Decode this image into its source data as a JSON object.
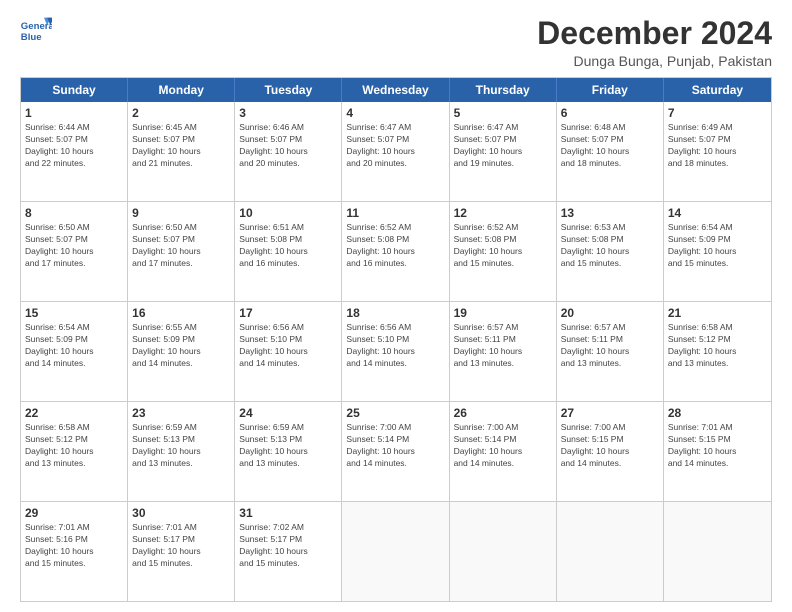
{
  "logo": {
    "line1": "General",
    "line2": "Blue"
  },
  "title": "December 2024",
  "subtitle": "Dunga Bunga, Punjab, Pakistan",
  "days_of_week": [
    "Sunday",
    "Monday",
    "Tuesday",
    "Wednesday",
    "Thursday",
    "Friday",
    "Saturday"
  ],
  "weeks": [
    [
      {
        "day": "1",
        "sunrise": "Sunrise: 6:44 AM",
        "sunset": "Sunset: 5:07 PM",
        "daylight": "Daylight: 10 hours and 22 minutes."
      },
      {
        "day": "2",
        "sunrise": "Sunrise: 6:45 AM",
        "sunset": "Sunset: 5:07 PM",
        "daylight": "Daylight: 10 hours and 21 minutes."
      },
      {
        "day": "3",
        "sunrise": "Sunrise: 6:46 AM",
        "sunset": "Sunset: 5:07 PM",
        "daylight": "Daylight: 10 hours and 20 minutes."
      },
      {
        "day": "4",
        "sunrise": "Sunrise: 6:47 AM",
        "sunset": "Sunset: 5:07 PM",
        "daylight": "Daylight: 10 hours and 20 minutes."
      },
      {
        "day": "5",
        "sunrise": "Sunrise: 6:47 AM",
        "sunset": "Sunset: 5:07 PM",
        "daylight": "Daylight: 10 hours and 19 minutes."
      },
      {
        "day": "6",
        "sunrise": "Sunrise: 6:48 AM",
        "sunset": "Sunset: 5:07 PM",
        "daylight": "Daylight: 10 hours and 18 minutes."
      },
      {
        "day": "7",
        "sunrise": "Sunrise: 6:49 AM",
        "sunset": "Sunset: 5:07 PM",
        "daylight": "Daylight: 10 hours and 18 minutes."
      }
    ],
    [
      {
        "day": "8",
        "sunrise": "Sunrise: 6:50 AM",
        "sunset": "Sunset: 5:07 PM",
        "daylight": "Daylight: 10 hours and 17 minutes."
      },
      {
        "day": "9",
        "sunrise": "Sunrise: 6:50 AM",
        "sunset": "Sunset: 5:07 PM",
        "daylight": "Daylight: 10 hours and 17 minutes."
      },
      {
        "day": "10",
        "sunrise": "Sunrise: 6:51 AM",
        "sunset": "Sunset: 5:08 PM",
        "daylight": "Daylight: 10 hours and 16 minutes."
      },
      {
        "day": "11",
        "sunrise": "Sunrise: 6:52 AM",
        "sunset": "Sunset: 5:08 PM",
        "daylight": "Daylight: 10 hours and 16 minutes."
      },
      {
        "day": "12",
        "sunrise": "Sunrise: 6:52 AM",
        "sunset": "Sunset: 5:08 PM",
        "daylight": "Daylight: 10 hours and 15 minutes."
      },
      {
        "day": "13",
        "sunrise": "Sunrise: 6:53 AM",
        "sunset": "Sunset: 5:08 PM",
        "daylight": "Daylight: 10 hours and 15 minutes."
      },
      {
        "day": "14",
        "sunrise": "Sunrise: 6:54 AM",
        "sunset": "Sunset: 5:09 PM",
        "daylight": "Daylight: 10 hours and 15 minutes."
      }
    ],
    [
      {
        "day": "15",
        "sunrise": "Sunrise: 6:54 AM",
        "sunset": "Sunset: 5:09 PM",
        "daylight": "Daylight: 10 hours and 14 minutes."
      },
      {
        "day": "16",
        "sunrise": "Sunrise: 6:55 AM",
        "sunset": "Sunset: 5:09 PM",
        "daylight": "Daylight: 10 hours and 14 minutes."
      },
      {
        "day": "17",
        "sunrise": "Sunrise: 6:56 AM",
        "sunset": "Sunset: 5:10 PM",
        "daylight": "Daylight: 10 hours and 14 minutes."
      },
      {
        "day": "18",
        "sunrise": "Sunrise: 6:56 AM",
        "sunset": "Sunset: 5:10 PM",
        "daylight": "Daylight: 10 hours and 14 minutes."
      },
      {
        "day": "19",
        "sunrise": "Sunrise: 6:57 AM",
        "sunset": "Sunset: 5:11 PM",
        "daylight": "Daylight: 10 hours and 13 minutes."
      },
      {
        "day": "20",
        "sunrise": "Sunrise: 6:57 AM",
        "sunset": "Sunset: 5:11 PM",
        "daylight": "Daylight: 10 hours and 13 minutes."
      },
      {
        "day": "21",
        "sunrise": "Sunrise: 6:58 AM",
        "sunset": "Sunset: 5:12 PM",
        "daylight": "Daylight: 10 hours and 13 minutes."
      }
    ],
    [
      {
        "day": "22",
        "sunrise": "Sunrise: 6:58 AM",
        "sunset": "Sunset: 5:12 PM",
        "daylight": "Daylight: 10 hours and 13 minutes."
      },
      {
        "day": "23",
        "sunrise": "Sunrise: 6:59 AM",
        "sunset": "Sunset: 5:13 PM",
        "daylight": "Daylight: 10 hours and 13 minutes."
      },
      {
        "day": "24",
        "sunrise": "Sunrise: 6:59 AM",
        "sunset": "Sunset: 5:13 PM",
        "daylight": "Daylight: 10 hours and 13 minutes."
      },
      {
        "day": "25",
        "sunrise": "Sunrise: 7:00 AM",
        "sunset": "Sunset: 5:14 PM",
        "daylight": "Daylight: 10 hours and 14 minutes."
      },
      {
        "day": "26",
        "sunrise": "Sunrise: 7:00 AM",
        "sunset": "Sunset: 5:14 PM",
        "daylight": "Daylight: 10 hours and 14 minutes."
      },
      {
        "day": "27",
        "sunrise": "Sunrise: 7:00 AM",
        "sunset": "Sunset: 5:15 PM",
        "daylight": "Daylight: 10 hours and 14 minutes."
      },
      {
        "day": "28",
        "sunrise": "Sunrise: 7:01 AM",
        "sunset": "Sunset: 5:15 PM",
        "daylight": "Daylight: 10 hours and 14 minutes."
      }
    ],
    [
      {
        "day": "29",
        "sunrise": "Sunrise: 7:01 AM",
        "sunset": "Sunset: 5:16 PM",
        "daylight": "Daylight: 10 hours and 15 minutes."
      },
      {
        "day": "30",
        "sunrise": "Sunrise: 7:01 AM",
        "sunset": "Sunset: 5:17 PM",
        "daylight": "Daylight: 10 hours and 15 minutes."
      },
      {
        "day": "31",
        "sunrise": "Sunrise: 7:02 AM",
        "sunset": "Sunset: 5:17 PM",
        "daylight": "Daylight: 10 hours and 15 minutes."
      },
      {
        "day": "",
        "sunrise": "",
        "sunset": "",
        "daylight": ""
      },
      {
        "day": "",
        "sunrise": "",
        "sunset": "",
        "daylight": ""
      },
      {
        "day": "",
        "sunrise": "",
        "sunset": "",
        "daylight": ""
      },
      {
        "day": "",
        "sunrise": "",
        "sunset": "",
        "daylight": ""
      }
    ]
  ]
}
